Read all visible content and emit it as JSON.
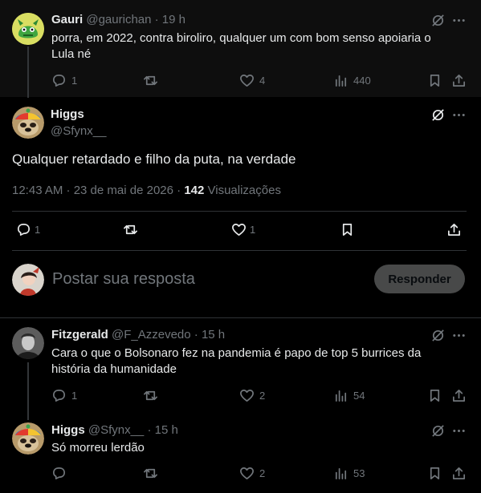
{
  "parent_tweet": {
    "name": "Gauri",
    "handle": "@gaurichan",
    "time": "· 19 h",
    "text_line1": "porra, em 2022, contra biroliro, qualquer um com bom senso apoiaria o",
    "text_line2": "Lula né",
    "replies": "1",
    "likes": "4",
    "views": "440"
  },
  "main_tweet": {
    "name": "Higgs",
    "handle": "@Sfynx__",
    "text": "Qualquer retardado e filho da puta, na verdade",
    "timestamp": "12:43 AM · 23 de mai de 2026 ·",
    "view_count": "142",
    "view_label": "Visualizações",
    "replies": "1",
    "likes": "1"
  },
  "compose": {
    "placeholder": "Postar sua resposta",
    "button_label": "Responder"
  },
  "replies": [
    {
      "name": "Fitzgerald",
      "handle": "@F_Azzevedo",
      "time": "· 15 h",
      "text_line1": "Cara o que o Bolsonaro fez na pandemia é papo de top 5 burrices da",
      "text_line2": "história da humanidade",
      "replies": "1",
      "likes": "2",
      "views": "54"
    },
    {
      "name": "Higgs",
      "handle": "@Sfynx__",
      "time": "· 15 h",
      "text_line1": "Só morreu lerdão",
      "likes": "2",
      "views": "53"
    }
  ],
  "icons": [
    "grok-icon",
    "more-icon",
    "reply-icon",
    "retweet-icon",
    "like-icon",
    "views-icon",
    "bookmark-icon",
    "share-icon"
  ],
  "colors": {
    "background": "#000000",
    "parent_background": "#0e0e0e",
    "muted": "#71767b",
    "text": "#e7e9ea",
    "border": "#2f3336"
  }
}
